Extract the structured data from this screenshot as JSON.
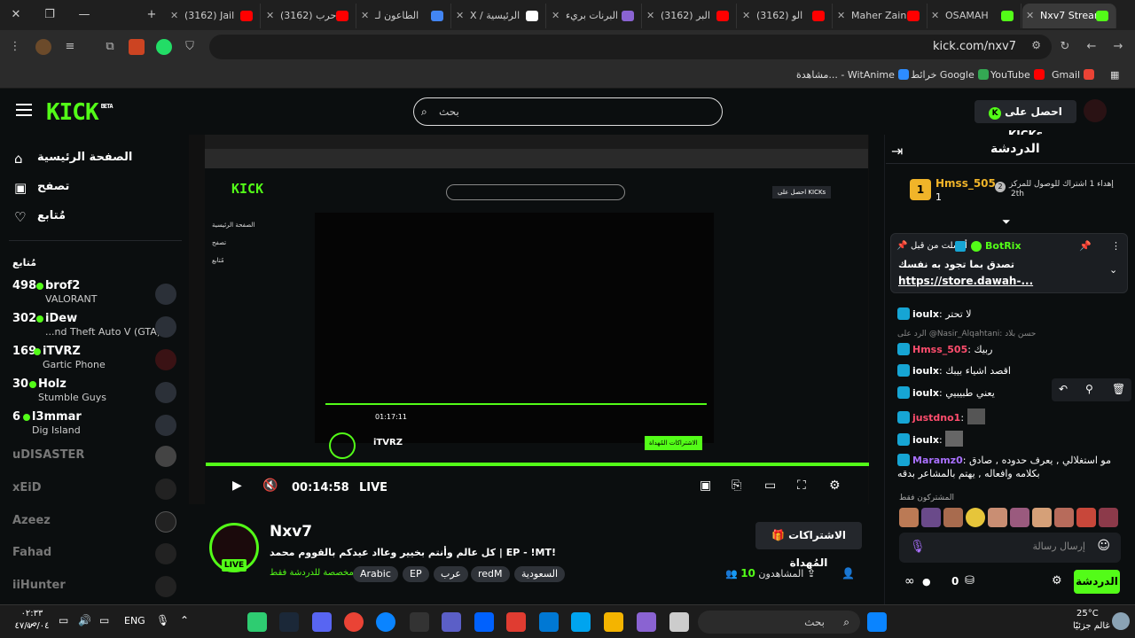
{
  "browser": {
    "tabs": [
      {
        "title": "(3162) Jail",
        "color": "#ff0000"
      },
      {
        "title": "(3162) حرب",
        "color": "#ff0000"
      },
      {
        "title": "الطاعون لـ",
        "color": "#4285f4"
      },
      {
        "title": "X / الرئيسية",
        "color": "#ffffff"
      },
      {
        "title": "البرنات بريء",
        "color": "#8a63d2"
      },
      {
        "title": "(3162) البر",
        "color": "#ff0000"
      },
      {
        "title": "(3162) الو",
        "color": "#ff0000"
      },
      {
        "title": "Maher Zain",
        "color": "#ff0000"
      },
      {
        "title": "OSAMAH",
        "color": "#53fc18"
      },
      {
        "title": "Nxv7 Stream",
        "color": "#53fc18"
      }
    ],
    "url": "kick.com/nxv7",
    "bookmarks": [
      {
        "label": "Gmail",
        "color": "#ea4335"
      },
      {
        "label": "YouTube",
        "color": "#ff0000"
      },
      {
        "label": "خرائط Google",
        "color": "#34a853"
      },
      {
        "label": "مشاهدة... - WitAnime",
        "color": "#2d8cff"
      }
    ],
    "all_bookmarks_icon": "grid-icon"
  },
  "header": {
    "logo": "KICK",
    "logo_sup": "BETA",
    "search_placeholder": "بحث",
    "get_kicks": "احصل على KICKs"
  },
  "sidebar": {
    "nav": [
      {
        "label": "الصفحة الرئيسية",
        "icon": "home-icon"
      },
      {
        "label": "تصفح",
        "icon": "browse-icon"
      },
      {
        "label": "مُتابع",
        "icon": "heart-icon"
      }
    ],
    "following_heading": "مُتابع",
    "live_channels": [
      {
        "count": "498",
        "name": "brof2",
        "game": "VALORANT"
      },
      {
        "count": "302",
        "name": "iDew",
        "game": "...nd Theft Auto V (GTA)"
      },
      {
        "count": "169",
        "name": "iTVRZ",
        "game": "Gartic Phone"
      },
      {
        "count": "30",
        "name": "Holz",
        "game": "Stumble Guys"
      },
      {
        "count": "6",
        "name": "l3mmar",
        "game": "Dig Island"
      }
    ],
    "offline_channels": [
      "uDISASTER",
      "xEiD",
      "Azeez",
      "Fahad",
      "iiHunter"
    ]
  },
  "player": {
    "time": "00:14:58",
    "live": "LIVE",
    "inner": {
      "side_items": [
        "الصفحة الرئيسية",
        "تصفح",
        "مُتابع"
      ],
      "time": "01:17:11",
      "streamer": "iTVRZ",
      "subs": "الاشتراكات المُهداة"
    }
  },
  "stream": {
    "name": "Nxv7",
    "title": "كل عالم وأنتم بخيير وعااد عيدكم بالقووم محمد | EP - !MT!",
    "tags": [
      "السعودية",
      "redM",
      "عرب",
      "EP",
      "Arabic"
    ],
    "chat_only": "مخصصة للدردشة فقط",
    "viewers_label": "المشاهدون",
    "viewers_count": "10",
    "subs_button": "الاشتراكات المُهداة",
    "live_badge": "LIVE"
  },
  "chat": {
    "title": "الدردشة",
    "gift_top_user": "Hmss_505",
    "gift_top_count": "1",
    "gift_text": "إهداء 1 اشتراك للوصول للمركز",
    "gift_rank": "2th",
    "pinned": {
      "sender": "BotRix",
      "sent_by": "أرسلت من قبل",
      "text": "تصدق بما تجود به نفسك",
      "link": "https://store.dawah-..."
    },
    "messages": [
      {
        "user": "ioulx",
        "color": "#ffffff",
        "text": "لا تحتر"
      },
      {
        "reply": "الرد على",
        "reply_user": "@Nasir_Alqahtani: حسن بلاد"
      },
      {
        "user": "Hmss_505",
        "color": "#ff4d6d",
        "text": "ربيك"
      },
      {
        "user": "ioulx",
        "color": "#ffffff",
        "text": "اقصد اشياء بيبك"
      },
      {
        "user": "ioulx",
        "color": "#ffffff",
        "text": "يعني طبيبيي"
      },
      {
        "user": "justdno1",
        "color": "#ff4d6d",
        "text": ""
      },
      {
        "user": "ioulx",
        "color": "#ffffff",
        "text": ""
      },
      {
        "user": "Maramz0",
        "color": "#a970ff",
        "text": "مو استغلالي , يعرف حدوده , صادق"
      },
      {
        "user": "",
        "color": "#ffffff",
        "text": "بكلامه وافعاله , يهتم بالمشاعر بدقه"
      }
    ],
    "emotes_label": "المشتركون فقط",
    "input_placeholder": "إرسال رسالة",
    "send_label": "الدردشة",
    "kicks_count": "0"
  },
  "taskbar": {
    "search": "بحث",
    "lang": "ENG",
    "time": "٠٢:٣٣ ص",
    "date": "٤٧/١٠/٠٤",
    "weather_temp": "25°C",
    "weather_text": "غالم جزئيًا"
  }
}
